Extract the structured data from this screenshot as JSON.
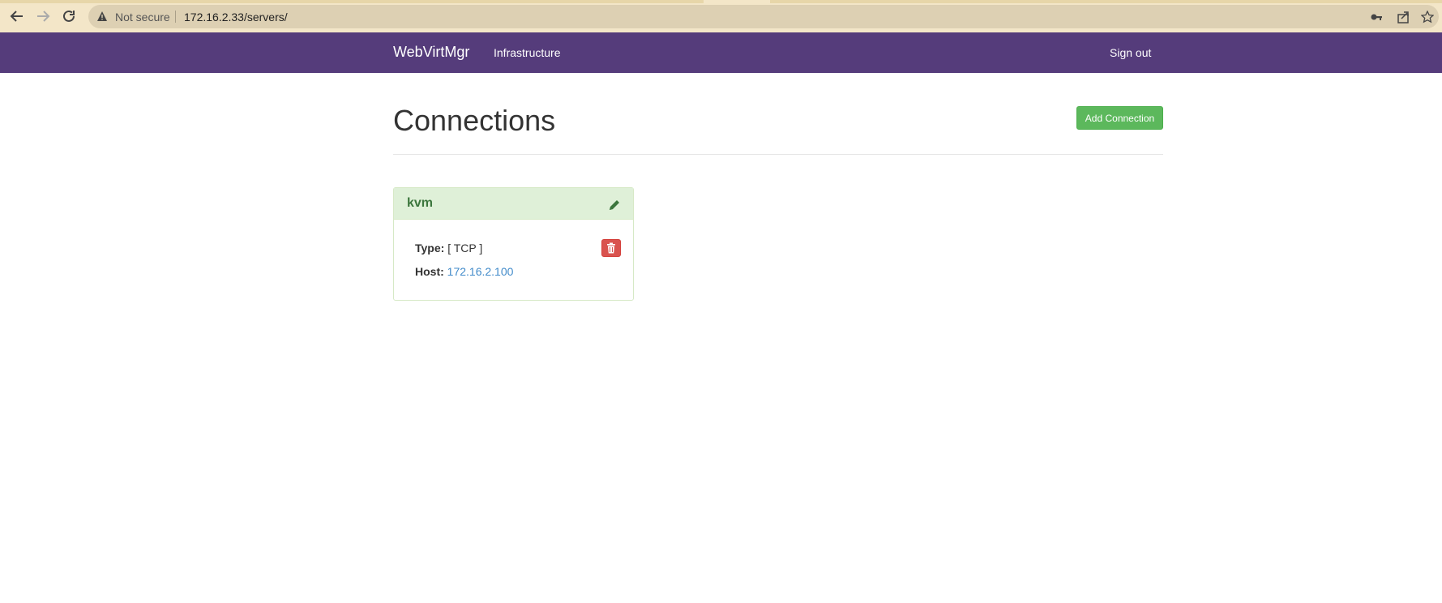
{
  "browser": {
    "security_label": "Not secure",
    "url": "172.16.2.33/servers/"
  },
  "navbar": {
    "brand": "WebVirtMgr",
    "links": [
      {
        "label": "Infrastructure"
      }
    ],
    "sign_out": "Sign out"
  },
  "page": {
    "title": "Connections",
    "add_button": "Add Connection"
  },
  "connections": [
    {
      "name": "kvm",
      "type_label": "Type:",
      "type_value": "[ TCP ]",
      "host_label": "Host:",
      "host_value": "172.16.2.100"
    }
  ],
  "colors": {
    "navbar": "#553c7b",
    "success": "#5cb85c",
    "danger": "#d9534f",
    "panel_heading": "#dff0d8",
    "link": "#428bca"
  }
}
